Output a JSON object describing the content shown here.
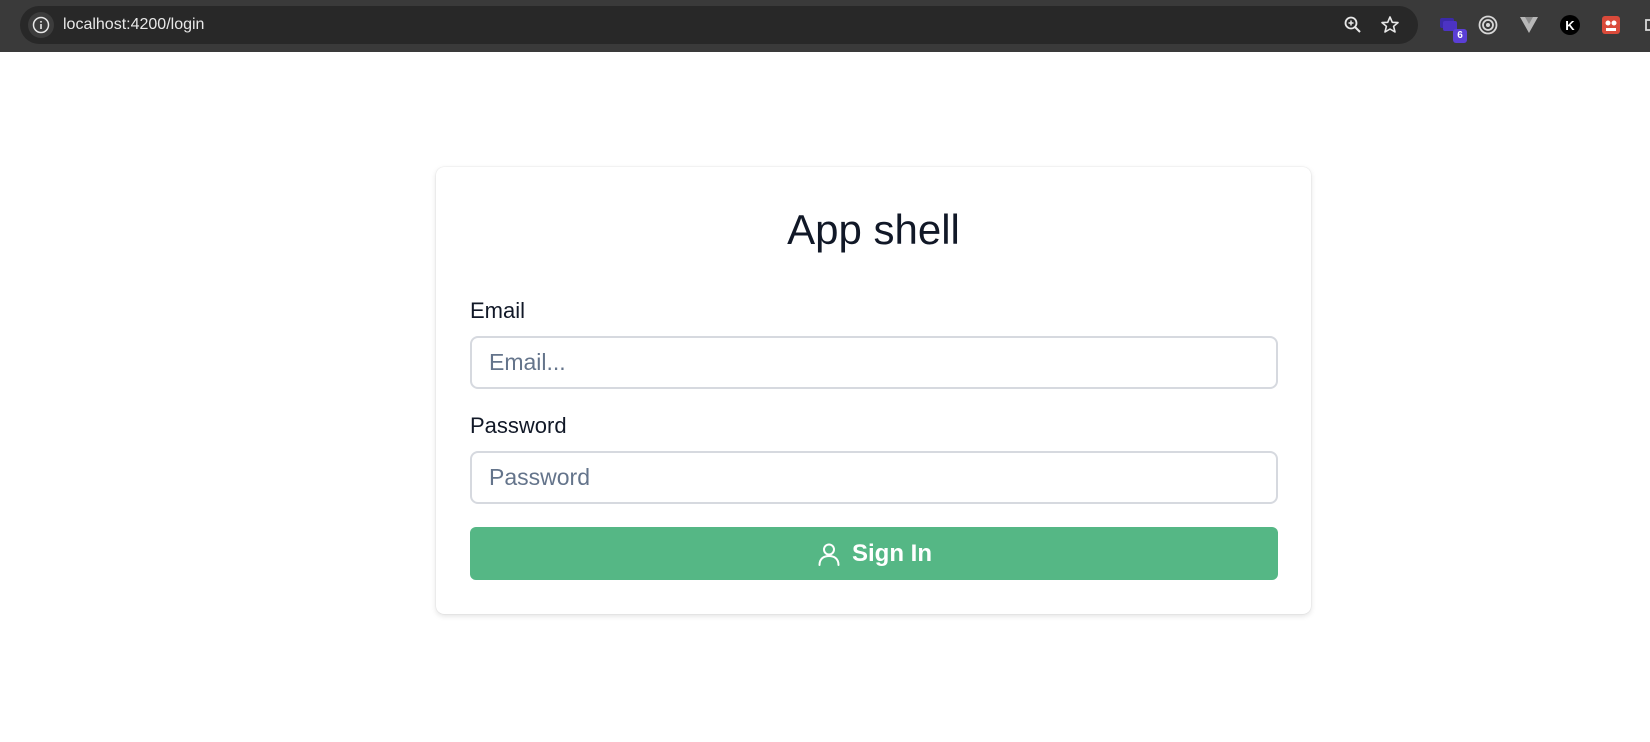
{
  "browser": {
    "url": "localhost:4200/login",
    "extensions": [
      {
        "icon": "stacked-extension-icon",
        "badge": "6"
      },
      {
        "icon": "target-extension-icon"
      },
      {
        "icon": "vue-devtools-icon"
      },
      {
        "icon": "k-extension-icon"
      },
      {
        "icon": "red-face-extension-icon"
      }
    ]
  },
  "login": {
    "title": "App shell",
    "email_label": "Email",
    "email_value": "",
    "email_placeholder": "Email...",
    "password_label": "Password",
    "password_value": "",
    "password_placeholder": "Password",
    "submit_label": "Sign In"
  },
  "colors": {
    "browser_bar": "#3a3a3a",
    "omnibox": "#282828",
    "primary_button": "#55b785",
    "title_text": "#111827",
    "placeholder_text": "#64748b"
  }
}
